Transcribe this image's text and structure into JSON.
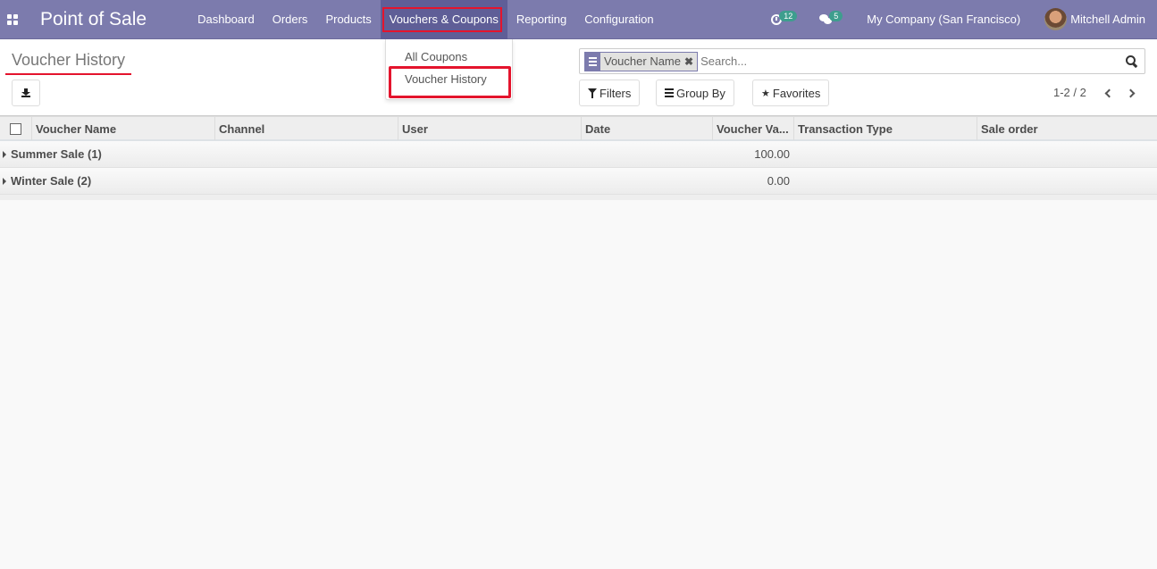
{
  "navbar": {
    "app_title": "Point of Sale",
    "menu": [
      {
        "label": "Dashboard"
      },
      {
        "label": "Orders"
      },
      {
        "label": "Products"
      },
      {
        "label": "Vouchers & Coupons",
        "active": true
      },
      {
        "label": "Reporting"
      },
      {
        "label": "Configuration"
      }
    ],
    "activity_count": "12",
    "messages_count": "5",
    "company": "My Company (San Francisco)",
    "user": "Mitchell Admin",
    "highlight_color": "#e4142d",
    "brand_color": "#7c7bad"
  },
  "dropdown": {
    "items": [
      {
        "label": "All Coupons"
      },
      {
        "label": "Voucher History",
        "highlighted": true
      }
    ]
  },
  "control_panel": {
    "title": "Voucher History",
    "search": {
      "facet_label": "Voucher Name",
      "placeholder": "Search..."
    },
    "filters_label": "Filters",
    "group_by_label": "Group By",
    "favorites_label": "Favorites",
    "pager": "1-2 / 2"
  },
  "table": {
    "columns": [
      "Voucher Name",
      "Channel",
      "User",
      "Date",
      "Voucher Va...",
      "Transaction Type",
      "Sale order"
    ],
    "groups": [
      {
        "name": "Summer Sale (1)",
        "voucher_value": "100.00"
      },
      {
        "name": "Winter Sale (2)",
        "voucher_value": "0.00"
      }
    ]
  }
}
